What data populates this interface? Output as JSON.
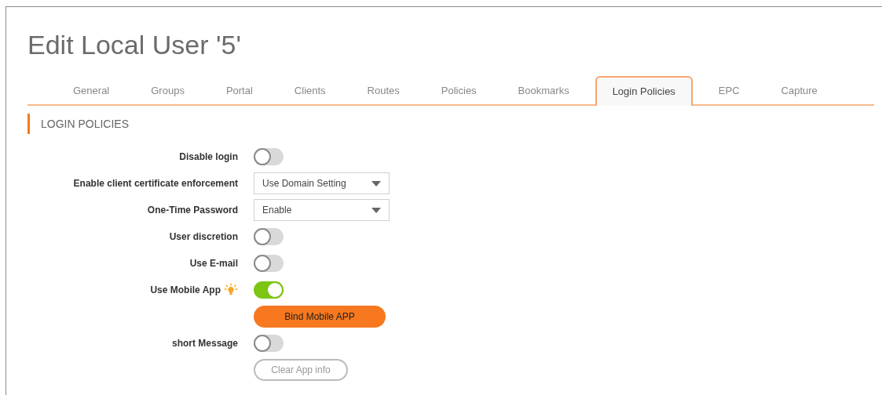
{
  "title": "Edit Local User '5'",
  "tabs": [
    {
      "label": "General",
      "selected": false
    },
    {
      "label": "Groups",
      "selected": false
    },
    {
      "label": "Portal",
      "selected": false
    },
    {
      "label": "Clients",
      "selected": false
    },
    {
      "label": "Routes",
      "selected": false
    },
    {
      "label": "Policies",
      "selected": false
    },
    {
      "label": "Bookmarks",
      "selected": false
    },
    {
      "label": "Login Policies",
      "selected": true
    },
    {
      "label": "EPC",
      "selected": false
    },
    {
      "label": "Capture",
      "selected": false
    }
  ],
  "section": "LOGIN POLICIES",
  "rows": [
    {
      "kind": "toggle",
      "label": "Disable login",
      "on": false,
      "tip": false
    },
    {
      "kind": "select",
      "label": "Enable client certificate enforcement",
      "value": "Use Domain Setting"
    },
    {
      "kind": "select",
      "label": "One-Time Password",
      "value": "Enable"
    },
    {
      "kind": "toggle",
      "label": "User discretion",
      "on": false,
      "tip": false
    },
    {
      "kind": "toggle",
      "label": "Use E-mail",
      "on": false,
      "tip": false
    },
    {
      "kind": "toggle",
      "label": "Use Mobile App",
      "on": true,
      "tip": true
    },
    {
      "kind": "button",
      "label": "Bind Mobile APP",
      "primary": true
    },
    {
      "kind": "toggle",
      "label": "short Message",
      "on": false,
      "tip": false
    },
    {
      "kind": "button",
      "label": "Clear App info",
      "primary": false
    }
  ]
}
